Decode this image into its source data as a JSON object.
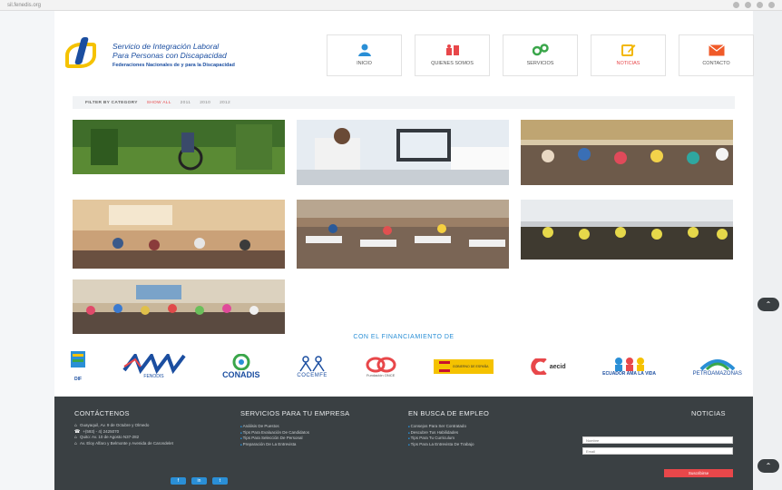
{
  "logo": {
    "line1": "Servicio de Integración Laboral",
    "line2": "Para Personas con Discapacidad",
    "sub": "Federaciones Nacionales de y para la Discapacidad"
  },
  "nav": [
    {
      "label": "INICIO",
      "icon": "person-icon",
      "color": "#2a8fd6"
    },
    {
      "label": "QUIENES SOMOS",
      "icon": "people-icon",
      "color": "#e8474a"
    },
    {
      "label": "SERVICIOS",
      "icon": "gears-icon",
      "color": "#3aa64a"
    },
    {
      "label": "NOTICIAS",
      "icon": "edit-icon",
      "color": "#f2b705",
      "active": true
    },
    {
      "label": "CONTACTO",
      "icon": "envelope-icon",
      "color": "#f05a28"
    }
  ],
  "filter": {
    "label": "FILTER BY CATEGORY",
    "options": [
      "SHOW ALL",
      "2011",
      "2010",
      "2012"
    ]
  },
  "financiamiento": "CON EL FINANCIAMIENTO DE",
  "sponsors": [
    "DIF",
    "FENODIS",
    "CONADIS",
    "COCEMFE",
    "Fundación ONCE",
    "GOBIERNO DE ESPAÑA",
    "aecid",
    "ECUADOR AMA LA VIDA",
    "PETROAMAZONAS"
  ],
  "footer": {
    "contact_title": "CONTÁCTENOS",
    "contact": [
      "Guayaquil, Av. 9 de Octubre y Olmedo",
      "+(593) - 4) 2425070",
      "Quito: Av. 10 de Agosto N37-282",
      "Av. Eloy Alfaro y Belmonte y Avenida de Carondelet"
    ],
    "services_title": "SERVICIOS PARA TU EMPRESA",
    "services": [
      "Análisis De Puestos",
      "Tips Para Evaluación De Candidatos",
      "Tips Para Selección De Personal",
      "Preparación De La Entrevista"
    ],
    "jobs_title": "EN BUSCA DE EMPLEO",
    "jobs": [
      "Consejos Para Ser Contratado",
      "Descubre Tus Habilidades",
      "Tips Para Tu Curriculum",
      "Tips Para La Entrevista De Trabajo"
    ],
    "news_title": "NOTICIAS",
    "name_placeholder": "Nombre",
    "email_placeholder": "Email",
    "subscribe": "Suscribirse",
    "social": [
      "f",
      "in",
      "t"
    ]
  },
  "url": "sil.fenedis.org",
  "colors": {
    "accent": "#2a8fd6",
    "red": "#e8474a",
    "footer": "#3a4043"
  }
}
